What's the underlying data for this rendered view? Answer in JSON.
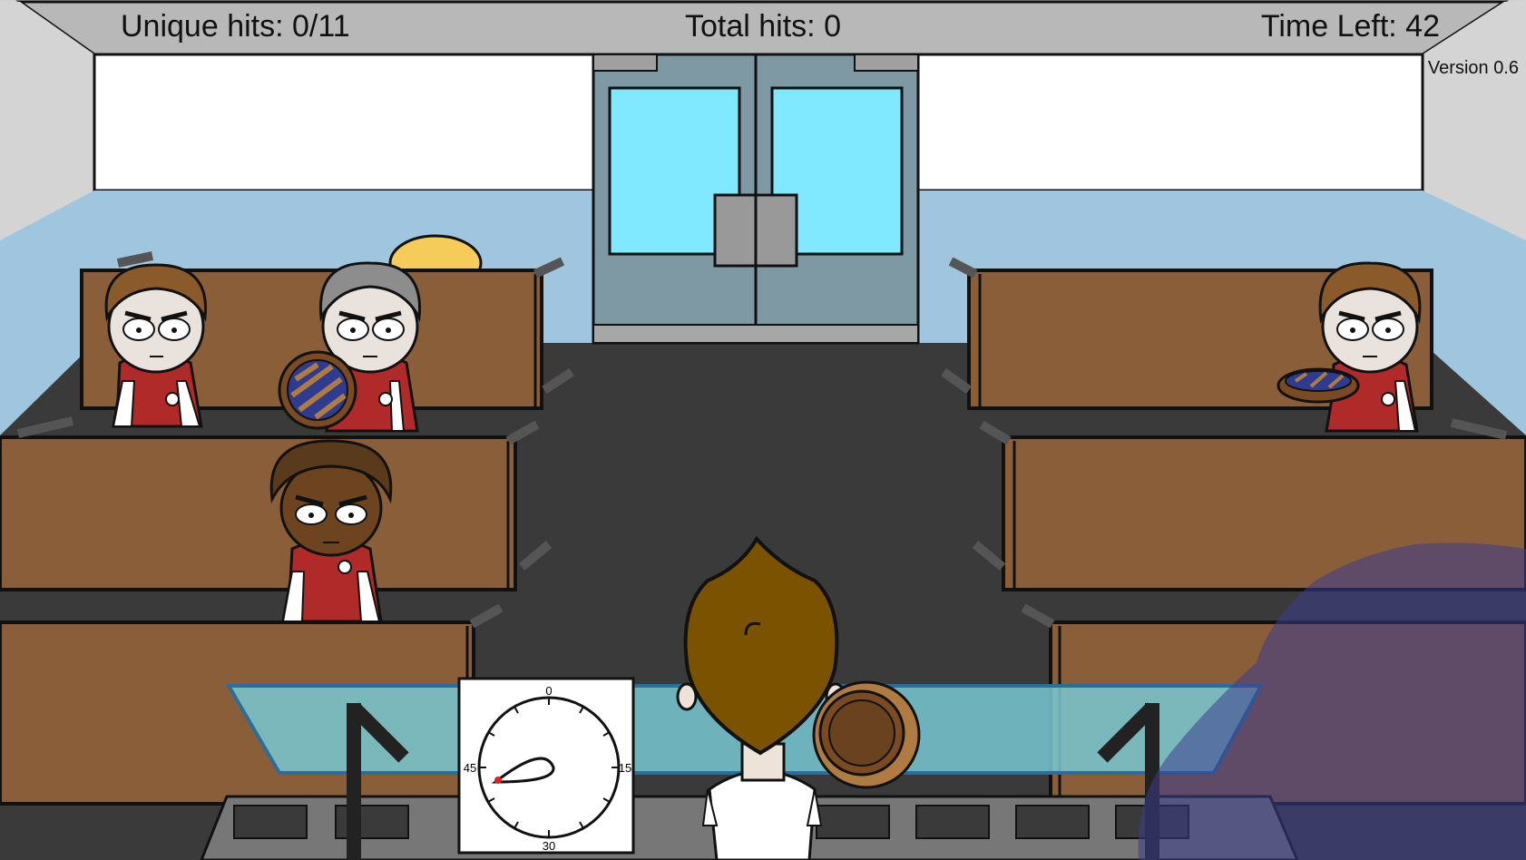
{
  "hud": {
    "unique_hits_label": "Unique hits: 0/11",
    "total_hits_label": "Total hits: 0",
    "time_left_label": "Time Left: 42",
    "version_label": "Version 0.6"
  },
  "timer_dial": {
    "labels": [
      "0",
      "15",
      "30",
      "45"
    ]
  },
  "colors": {
    "desk": "#8b5e3a",
    "floor": "#3a3a3a",
    "wall_blue": "#9fc5df",
    "door_glass": "#80e8ff",
    "jacket": "#b02a2a",
    "hair_player": "#7a5200",
    "counter_glass": "#78c8d4",
    "overlay": "#3c3c8c"
  },
  "characters": [
    {
      "name": "student-left-back-1",
      "hair": "brown"
    },
    {
      "name": "student-left-back-2",
      "hair": "gray",
      "holding": "pie"
    },
    {
      "name": "student-left-middle",
      "hair": "dark-brown",
      "skin": "dark"
    },
    {
      "name": "student-right-back",
      "hair": "brown",
      "holding": "pie"
    },
    {
      "name": "player",
      "hair": "brown",
      "holding": "pie"
    }
  ]
}
